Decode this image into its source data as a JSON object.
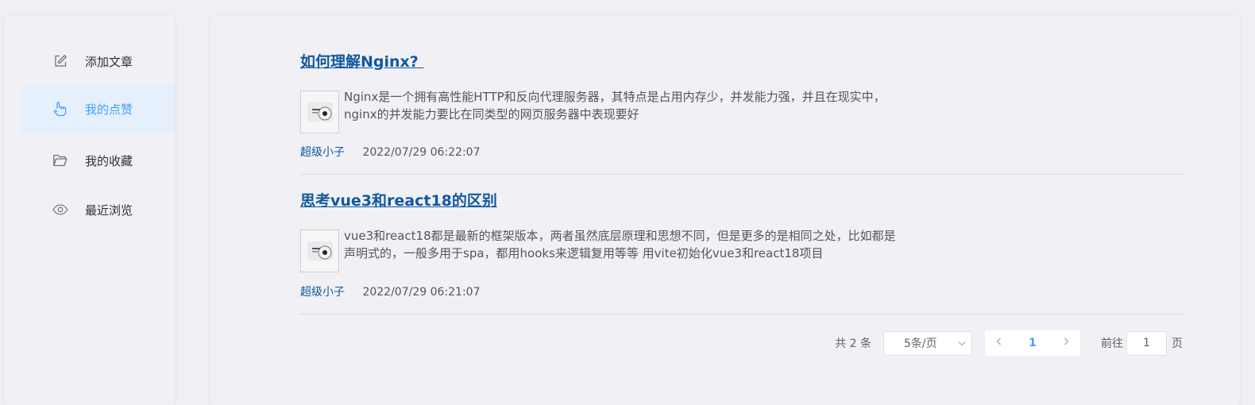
{
  "sidebar": {
    "items": [
      {
        "label": "添加文章",
        "icon": "edit-icon"
      },
      {
        "label": "我的点赞",
        "icon": "like-icon"
      },
      {
        "label": "我的收藏",
        "icon": "folder-icon"
      },
      {
        "label": "最近浏览",
        "icon": "eye-icon"
      }
    ],
    "active": "我的点赞"
  },
  "articles": [
    {
      "title": "如何理解Nginx? ",
      "summary_line1": "Nginx是一个拥有高性能HTTP和反向代理服务器，其特点是占用内存少，并发能力强，并且在现实中，",
      "summary_line2": "nginx的并发能力要比在同类型的网页服务器中表现要好",
      "author": "超级小子",
      "time": "2022/07/29 06:22:07"
    },
    {
      "title": "思考vue3和react18的区别",
      "summary_line1": "vue3和react18都是最新的框架版本，两者虽然底层原理和思想不同，但是更多的是相同之处，比如都是",
      "summary_line2": "声明式的，一般多用于spa，都用hooks来逻辑复用等等 用vite初始化vue3和react18项目",
      "author": "超级小子",
      "time": "2022/07/29 06:21:07"
    }
  ],
  "pagination": {
    "total": "共 2 条",
    "page_size": "5条/页",
    "current_page": "1",
    "goto_prefix": "前往",
    "goto_value": "1",
    "goto_suffix": "页"
  },
  "colors": {
    "accent": "#409eff",
    "link": "#10599e",
    "active_bg": "#e6f0fc"
  }
}
